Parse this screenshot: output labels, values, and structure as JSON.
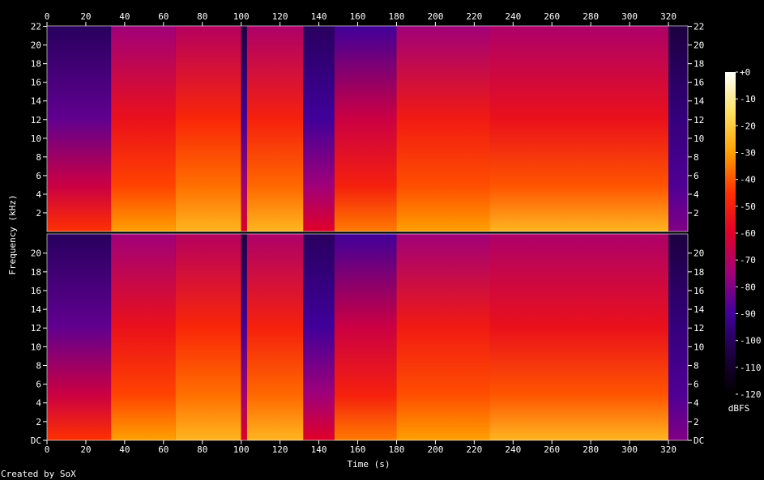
{
  "chart_data": {
    "type": "heatmap",
    "title": "",
    "xlabel": "Time (s)",
    "ylabel": "Frequency (kHz)",
    "xlim": [
      0,
      330
    ],
    "ylim": [
      0,
      22.05
    ],
    "x_ticks": [
      "0",
      "20",
      "40",
      "60",
      "80",
      "100",
      "120",
      "140",
      "160",
      "180",
      "200",
      "220",
      "240",
      "260",
      "280",
      "300",
      "320"
    ],
    "y_ticks_top": [
      "2",
      "4",
      "6",
      "8",
      "10",
      "12",
      "14",
      "16",
      "18",
      "20",
      "22"
    ],
    "y_ticks_bottom": [
      "DC",
      "2",
      "4",
      "6",
      "8",
      "10",
      "12",
      "14",
      "16",
      "18",
      "20"
    ],
    "colorbar": {
      "label": "dBFS",
      "ticks": [
        "+0",
        "-10",
        "-20",
        "-30",
        "-40",
        "-50",
        "-60",
        "-70",
        "-80",
        "-90",
        "-100",
        "-110",
        "-120"
      ],
      "range": [
        -120,
        0
      ],
      "colors": [
        "#000000",
        "#1c0040",
        "#40009a",
        "#a0007a",
        "#e00028",
        "#ff3000",
        "#ffa000",
        "#ffe060",
        "#ffffff"
      ]
    },
    "channels": [
      {
        "name": "",
        "segments": [
          {
            "t0": 0,
            "t1": 33,
            "low": -45,
            "mid": -85,
            "high": -100
          },
          {
            "t0": 33,
            "t1": 66,
            "low": -30,
            "mid": -55,
            "high": -75
          },
          {
            "t0": 66,
            "t1": 100,
            "low": -25,
            "mid": -48,
            "high": -70
          },
          {
            "t0": 100,
            "t1": 103,
            "low": -60,
            "mid": -90,
            "high": -105
          },
          {
            "t0": 103,
            "t1": 132,
            "low": -25,
            "mid": -50,
            "high": -72
          },
          {
            "t0": 132,
            "t1": 148,
            "low": -60,
            "mid": -90,
            "high": -100
          },
          {
            "t0": 148,
            "t1": 180,
            "low": -35,
            "mid": -65,
            "high": -90
          },
          {
            "t0": 180,
            "t1": 228,
            "low": -30,
            "mid": -52,
            "high": -75
          },
          {
            "t0": 228,
            "t1": 320,
            "low": -25,
            "mid": -55,
            "high": -72
          },
          {
            "t0": 320,
            "t1": 330,
            "low": -80,
            "mid": -95,
            "high": -105
          }
        ]
      },
      {
        "name": "",
        "segments": [
          {
            "t0": 0,
            "t1": 33,
            "low": -45,
            "mid": -85,
            "high": -100
          },
          {
            "t0": 33,
            "t1": 66,
            "low": -30,
            "mid": -55,
            "high": -75
          },
          {
            "t0": 66,
            "t1": 100,
            "low": -25,
            "mid": -48,
            "high": -70
          },
          {
            "t0": 100,
            "t1": 103,
            "low": -60,
            "mid": -90,
            "high": -105
          },
          {
            "t0": 103,
            "t1": 132,
            "low": -25,
            "mid": -50,
            "high": -72
          },
          {
            "t0": 132,
            "t1": 148,
            "low": -60,
            "mid": -90,
            "high": -100
          },
          {
            "t0": 148,
            "t1": 180,
            "low": -35,
            "mid": -65,
            "high": -90
          },
          {
            "t0": 180,
            "t1": 228,
            "low": -30,
            "mid": -52,
            "high": -75
          },
          {
            "t0": 228,
            "t1": 320,
            "low": -25,
            "mid": -55,
            "high": -72
          },
          {
            "t0": 320,
            "t1": 330,
            "low": -80,
            "mid": -95,
            "high": -105
          }
        ]
      }
    ]
  },
  "footer": {
    "credit": "Created by SoX"
  }
}
